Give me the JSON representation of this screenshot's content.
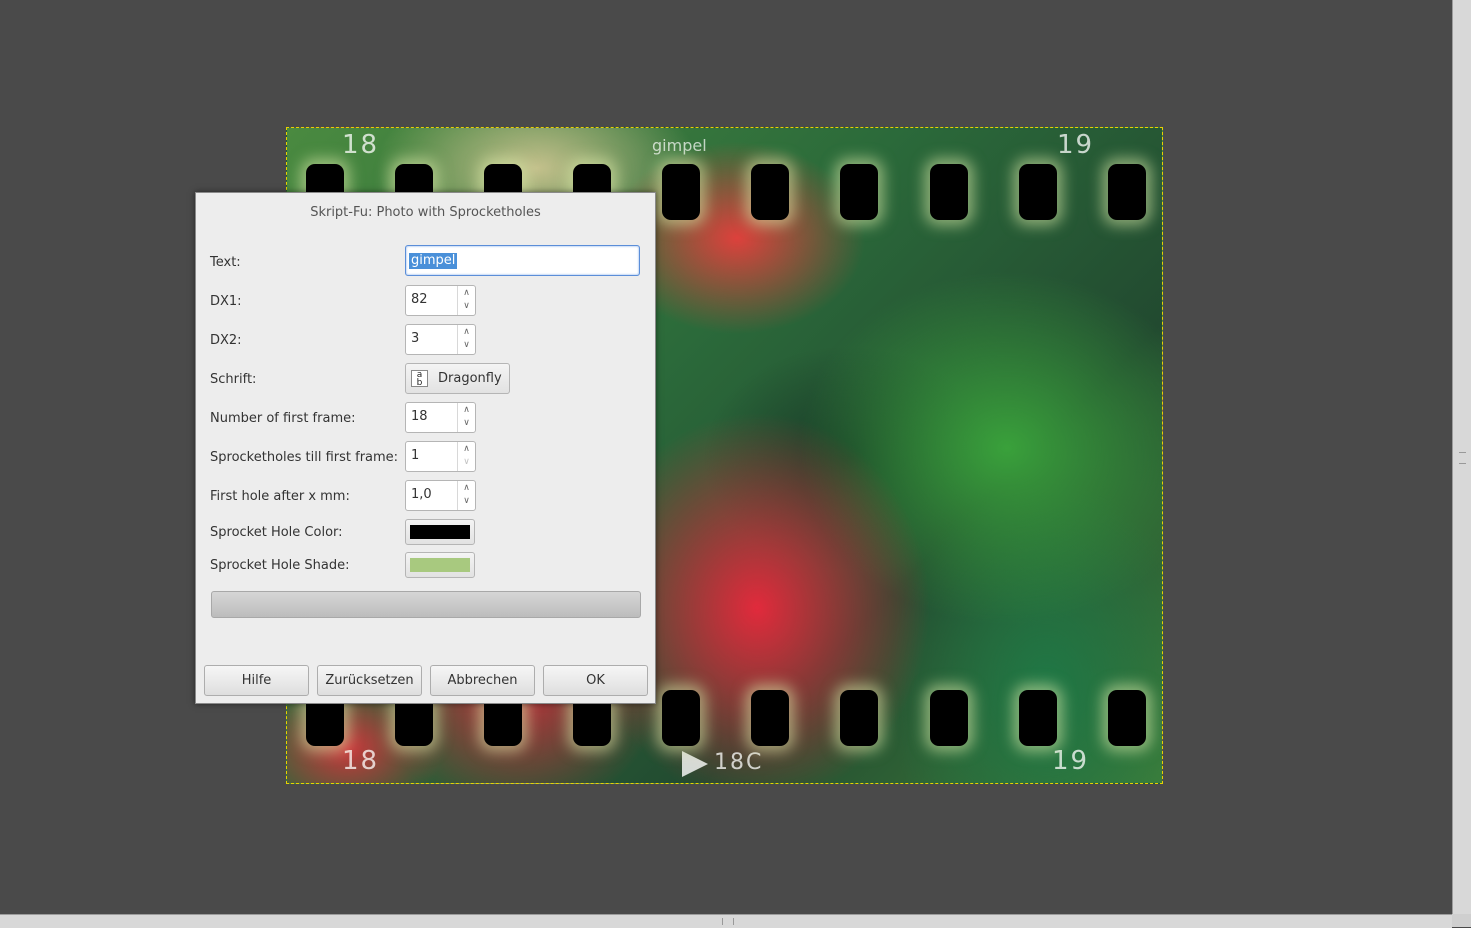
{
  "dialog": {
    "title": "Skript-Fu: Photo with Sprocketholes",
    "fields": {
      "text": {
        "label": "Text:",
        "value": "gimpel"
      },
      "dx1": {
        "label": "DX1:",
        "value": "82"
      },
      "dx2": {
        "label": "DX2:",
        "value": "3"
      },
      "font": {
        "label": "Schrift:",
        "value": "Dragonfly"
      },
      "first_frame": {
        "label": "Number of first frame:",
        "value": "18"
      },
      "holes_till_first": {
        "label": "Sprocketholes till first frame:",
        "value": "1"
      },
      "first_hole_mm": {
        "label": "First hole after x mm:",
        "value": "1,0"
      },
      "hole_color": {
        "label": "Sprocket Hole Color:",
        "color": "#000000"
      },
      "hole_shade": {
        "label": "Sprocket Hole Shade:",
        "color": "#a8c97f"
      }
    },
    "buttons": {
      "help": "Hilfe",
      "reset": "Zurücksetzen",
      "cancel": "Abbrechen",
      "ok": "OK"
    }
  },
  "canvas": {
    "film_text_top": "gimpel",
    "frame_numbers": {
      "top_left": "18",
      "top_right": "19",
      "bottom_left": "18",
      "bottom_mid": "18C",
      "bottom_right": "19"
    }
  },
  "icons": {
    "spin_up": "chevron-up-icon",
    "spin_down": "chevron-down-icon",
    "font": "font-icon"
  }
}
